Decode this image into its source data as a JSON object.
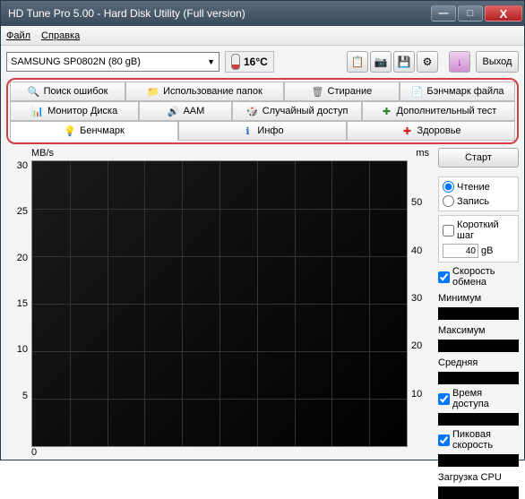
{
  "window_title": "HD Tune Pro 5.00 - Hard Disk Utility (Full version)",
  "menu": {
    "file": "Файл",
    "help": "Справка"
  },
  "drive": "SAMSUNG SP0802N (80 gB)",
  "temperature": "16°C",
  "exit_label": "Выход",
  "tabs": {
    "errorscan": "Поиск ошибок",
    "folderusage": "Использование папок",
    "erase": "Стирание",
    "filebench": "Бэнчмарк файла",
    "diskmon": "Монитор Диска",
    "aam": "AAM",
    "random": "Случайный доступ",
    "extra": "Дополнительный тест",
    "benchmark": "Бенчмарк",
    "info": "Инфо",
    "health": "Здоровье"
  },
  "chart": {
    "ylabel": "MB/s",
    "y2label": "ms",
    "yticks": [
      "30",
      "25",
      "20",
      "15",
      "10",
      "5"
    ],
    "y2ticks": [
      "",
      "50",
      "40",
      "30",
      "20",
      "10"
    ],
    "x_start": "0"
  },
  "side": {
    "start": "Старт",
    "read": "Чтение",
    "write": "Запись",
    "shortstroke": "Короткий шаг",
    "shortstroke_val": "40",
    "shortstroke_unit": "gB",
    "speed": "Скорость обмена",
    "min": "Минимум",
    "max": "Максимум",
    "avg": "Средняя",
    "access": "Время доступа",
    "burst": "Пиковая скорость",
    "cpu": "Загрузка CPU"
  },
  "chart_data": {
    "type": "line",
    "series": [],
    "xlabel": "",
    "ylabel": "MB/s",
    "y2label": "ms",
    "ylim": [
      0,
      30
    ],
    "y2lim": [
      0,
      50
    ],
    "title": ""
  }
}
